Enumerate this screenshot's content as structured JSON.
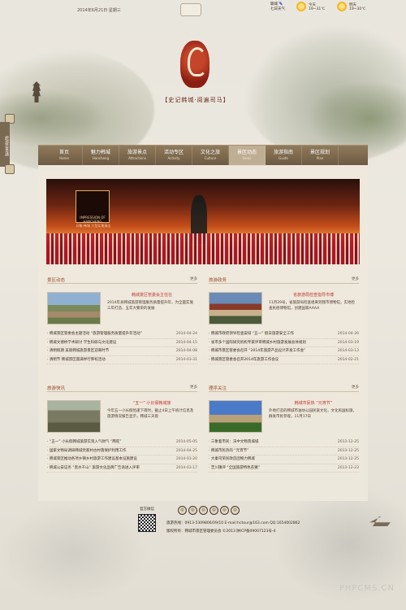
{
  "top": {
    "date": "2014年6月21日  星期三",
    "city_line1": "聊城 🌂",
    "city_line2": "七日天气",
    "today_label": "今天",
    "today_temp": "19~31℃",
    "tomorrow_label": "明天",
    "tomorrow_temp": "19~30℃"
  },
  "slogan": "【史记韩城·阅遍司马】",
  "side_tab": "旅游百事通",
  "nav": {
    "items": [
      {
        "cn": "首页",
        "en": "Home"
      },
      {
        "cn": "魅力韩城",
        "en": "Hancheng"
      },
      {
        "cn": "旅游景点",
        "en": "Attractions"
      },
      {
        "cn": "活动专区",
        "en": "Activity"
      },
      {
        "cn": "文化之旅",
        "en": "Culture"
      },
      {
        "cn": "景区动态",
        "en": "News"
      },
      {
        "cn": "旅游指南",
        "en": "Guide"
      },
      {
        "cn": "景区规划",
        "en": "Plan"
      }
    ],
    "active_index": 5
  },
  "banner": {
    "logo_text": "IMPRESSION OF HANCHENG",
    "logo_caption": "印象·韩城 大型实景演出"
  },
  "sections": [
    {
      "title": "景区动态",
      "more": "更多",
      "feature_title": "韩城景区管委会主任在",
      "feature_desc": "2014年县韩城旅游管理服务质量提升年，为全面实施三年打造、五年大繁荣的发展",
      "rows": [
        {
          "t": "· 韩城景区管委会主题活动 “旅游管理服务质量提升年活动”",
          "d": "2014-04-24"
        },
        {
          "t": "· 韩城文德桥学术研讨 学生科研与文化建设",
          "d": "2014-04-15"
        },
        {
          "t": "· 清明假期 美丽韩城旅游景区迎来时节",
          "d": "2014-04-08"
        },
        {
          "t": "· 清明节 韩城景区圆满举行祭祀活动",
          "d": "2014-03-31"
        }
      ]
    },
    {
      "title": "旅游政务",
      "more": "更多",
      "feature_title": "省旅游局检查指导市博",
      "feature_desc": "11月29号，省旅游局检查组来到我市博物馆，实地检查民俗博物馆，创建国家AAAA",
      "rows": [
        {
          "t": "· 韩城市政府领导检查安排 “五一” 假日旅游安全工作",
          "d": "2014-04-26"
        },
        {
          "t": "· 省市多个国际研究机构专家评审韩城乡村旅游发展总体规划",
          "d": "2014-03-19"
        },
        {
          "t": "· 韩城市景区管委会召开 “2014年旅游产品设计开发工作会”",
          "d": "2014-03-13"
        },
        {
          "t": "· 韩城景区管委会召开2014年旅游工作会议",
          "d": "2014-02-21"
        }
      ]
    },
    {
      "title": "旅游快讯",
      "more": "更多",
      "feature_title": "“五一” 小长假韩城旅",
      "feature_desc": "今年五一小长假恰逢下雨时，截止4日上午统计信息及旅游情况报告显示，韩城三天假",
      "rows": [
        {
          "t": "· “五一” 小长假韩城旅游实现入气财气 “两旺”",
          "d": "2014-05-05"
        },
        {
          "t": "· 国家文物局调研韩城党家村古村落保护利用工作",
          "d": "2014-04-25"
        },
        {
          "t": "· 韩城景区推动各项乡镇乡村旅游工作建设基本设施建设",
          "d": "2014-03-20"
        },
        {
          "t": "· 韩城公安证务 “黑水千山” 旅游文化品牌广告语进入评审",
          "d": "2014-03-17"
        }
      ]
    },
    {
      "title": "理序关注",
      "more": "更多",
      "feature_title": "韩城市民热 “元宵节”",
      "feature_desc": "外地打造的韩城市油坊公园民族文化，文化民国标旗，群发市民参观，11月17日",
      "rows": [
        {
          "t": "· 三象着市民：沃中文物景城城",
          "d": "2013-12-25"
        },
        {
          "t": "· 韩城市民热的 “元宵节”",
          "d": "2013-12-25"
        },
        {
          "t": "· 大秦司荣民政造团物力韩城",
          "d": "2013-12-25"
        },
        {
          "t": "· 芝川镇评 “全国旅游特色名镇”",
          "d": "2013-12-23"
        }
      ]
    }
  ],
  "footer": {
    "follow_label": "官方微信",
    "social_icons": [
      "weibo-icon",
      "qq-icon",
      "weixin-icon",
      "renren-icon",
      "douban-icon",
      "kaixin-icon"
    ],
    "line1": "旅游热线：0913-5309806/09/10    E-mail:hctour@163.com QQ:1654002862",
    "line2": "版权所有：韩城市景区管理委员会    ©2013  陕ICP备09007123号-4"
  },
  "watermark": "PHPCMS.CN"
}
